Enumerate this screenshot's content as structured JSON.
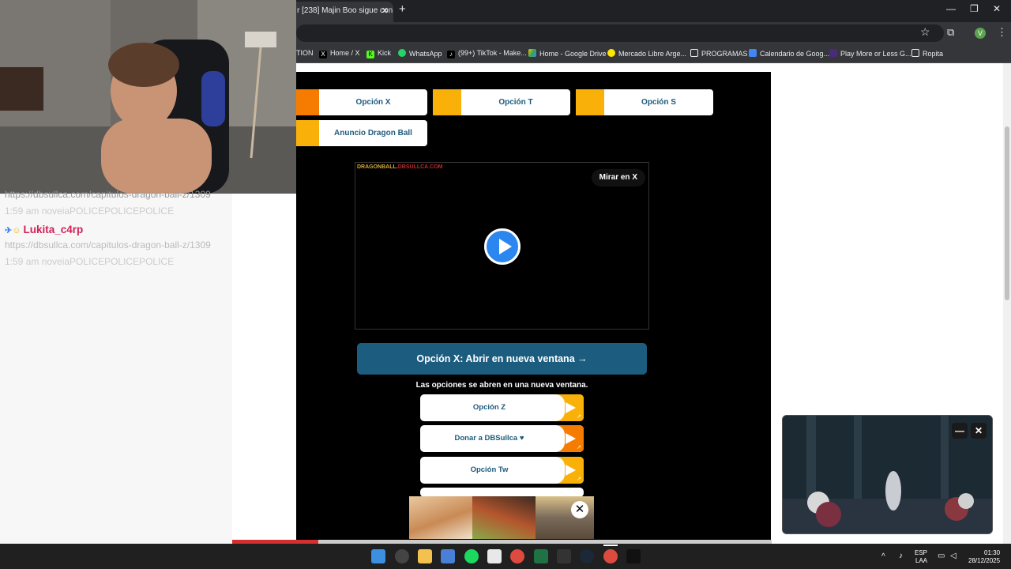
{
  "browser": {
    "tab_title": "r [238] Majin Boo sigue con",
    "tab_close": "✕",
    "new_tab": "+",
    "window_controls": {
      "minimize": "—",
      "maximize": "❐",
      "close": "✕"
    },
    "bookmarks": [
      {
        "label": "TION",
        "icon": "none"
      },
      {
        "label": "Home / X",
        "icon": "x-icon"
      },
      {
        "label": "Kick",
        "icon": "kick-icon"
      },
      {
        "label": "WhatsApp",
        "icon": "whatsapp-icon"
      },
      {
        "label": "(99+) TikTok - Make...",
        "icon": "tiktok-icon"
      },
      {
        "label": "Home - Google Drive",
        "icon": "drive-icon"
      },
      {
        "label": "Mercado Libre Arge...",
        "icon": "mercadolibre-icon"
      },
      {
        "label": "PROGRAMAS",
        "icon": "folder-icon"
      },
      {
        "label": "Calendario de Goog...",
        "icon": "calendar-icon"
      },
      {
        "label": "Play More or Less G...",
        "icon": "game-icon"
      },
      {
        "label": "Ropita",
        "icon": "folder-icon"
      }
    ],
    "profile_initial": "V"
  },
  "page": {
    "top_options": [
      {
        "label": "Opción X",
        "accent": "#f57c00"
      },
      {
        "label": "Opción T",
        "accent": "#f9b109"
      },
      {
        "label": "Opción S",
        "accent": "#f9b109"
      },
      {
        "label": "Anuncio Dragon Ball",
        "accent": "#f9b109"
      }
    ],
    "video": {
      "logo_main": "DRAGONBALL.",
      "logo_accent": "DBSULLCA.COM",
      "watch_on_x": "Mirar en X"
    },
    "main_button": "Opción X: Abrir en nueva ventana →",
    "note": "Las opciones se abren en una nueva ventana.",
    "option_list": [
      {
        "label": "Opción Z",
        "accent": "#f9b109"
      },
      {
        "label": "Donar a DBSullca ♥",
        "accent": "#f57c00"
      },
      {
        "label": "Opción Tw",
        "accent": "#f9b109"
      }
    ],
    "ad_close": "✕",
    "progress": 0.16
  },
  "chat": {
    "lines": [
      {
        "text": "https://dbsullca.com/capitulos-dragon-ball-z/1309",
        "style": "dim"
      },
      {
        "text": "1:59 am noveiaPOLICEPOLICEPOLICE",
        "style": "dim"
      },
      {
        "text": "Lukita_c4rp",
        "style": "user"
      },
      {
        "text": "https://dbsullca.com/capitulos-dragon-ball-z/1309",
        "style": "dim"
      },
      {
        "text": "1:59 am noveiaPOLICEPOLICEPOLICE",
        "style": "dim"
      }
    ]
  },
  "mini_player": {
    "minimize": "—",
    "close": "✕"
  },
  "taskbar": {
    "lang_top": "ESP",
    "lang_bottom": "LAA",
    "time": "01:30",
    "date": "28/12/2025"
  }
}
